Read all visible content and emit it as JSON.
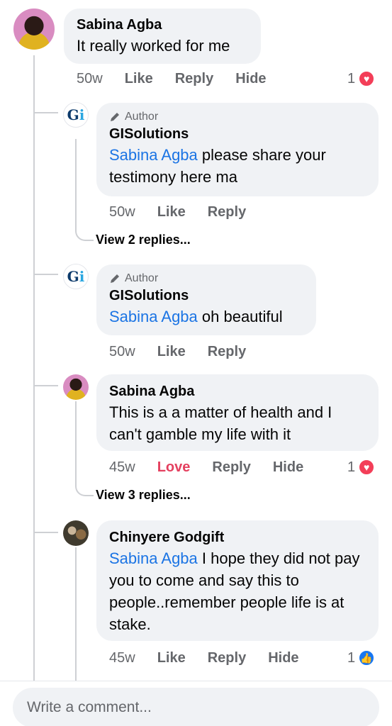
{
  "comments": {
    "top": {
      "author": "Sabina Agba",
      "text": "It really worked for me",
      "time": "50w",
      "like": "Like",
      "reply": "Reply",
      "hide": "Hide",
      "reaction_count": "1",
      "reaction": "love-icon"
    },
    "reply1": {
      "badge": "Author",
      "author": "GISolutions",
      "mention": "Sabina Agba",
      "text": " please share your testimony here ma",
      "time": "50w",
      "like": "Like",
      "reply": "Reply",
      "view_replies": "View 2 replies..."
    },
    "reply2": {
      "badge": "Author",
      "author": "GISolutions",
      "mention": "Sabina Agba",
      "text": " oh beautiful",
      "time": "50w",
      "like": "Like",
      "reply": "Reply"
    },
    "reply3": {
      "author": "Sabina Agba",
      "text": "This is a a matter of health and I can't gamble my life with it",
      "time": "45w",
      "love": "Love",
      "reply": "Reply",
      "hide": "Hide",
      "reaction_count": "1",
      "reaction": "love-icon",
      "view_replies": "View 3 replies..."
    },
    "reply4": {
      "author": "Chinyere Godgift",
      "mention": "Sabina Agba",
      "text": " I hope they did not pay you to come and say this to people..remember people life is at stake.",
      "time": "45w",
      "like": "Like",
      "reply": "Reply",
      "hide": "Hide",
      "reaction_count": "1",
      "reaction": "like-icon"
    }
  },
  "composer": {
    "placeholder": "Write a comment..."
  },
  "colors": {
    "mention": "#1b74e4",
    "love": "#e4405f",
    "bubble": "#f0f2f5"
  }
}
